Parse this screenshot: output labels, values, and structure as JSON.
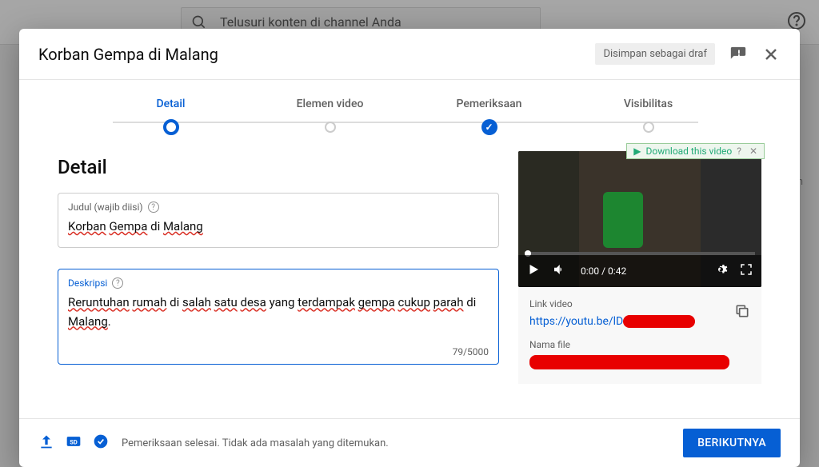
{
  "background": {
    "search_placeholder": "Telusuri konten di channel Anda",
    "side_text": "Kom"
  },
  "dialog": {
    "title": "Korban Gempa di Malang",
    "draft_status": "Disimpan sebagai draf",
    "steps": {
      "detail": "Detail",
      "elements": "Elemen video",
      "checks": "Pemeriksaan",
      "visibility": "Visibilitas"
    },
    "section_heading": "Detail",
    "title_field": {
      "label": "Judul (wajib diisi)",
      "value_parts": [
        "Korban",
        "Gempa",
        "di",
        "Malang"
      ]
    },
    "desc_field": {
      "label": "Deskripsi",
      "value_parts": [
        "Reruntuhan",
        "rumah",
        "di",
        "salah",
        "satu",
        "desa",
        "yang",
        "terdampak",
        "gempa",
        "cukup",
        "parah",
        "di",
        "Malang"
      ],
      "counter": "79/5000"
    },
    "video": {
      "download_badge": "Download this video",
      "time": "0:00 / 0:42",
      "link_label": "Link video",
      "link_value": "https://youtu.be/lD",
      "file_label": "Nama file"
    },
    "footer": {
      "status": "Pemeriksaan selesai. Tidak ada masalah yang ditemukan.",
      "next": "BERIKUTNYA"
    }
  }
}
